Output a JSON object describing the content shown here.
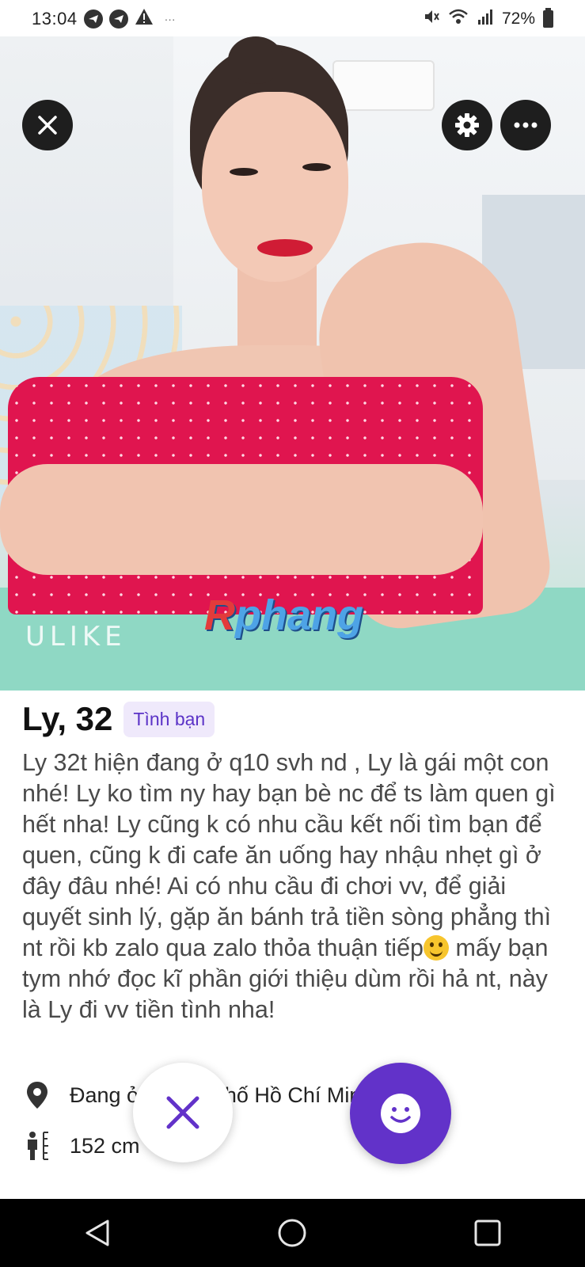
{
  "status_bar": {
    "time": "13:04",
    "battery": "72%",
    "icons": [
      "telegram-icon",
      "telegram-icon",
      "warning-icon",
      "more-dots-icon",
      "mute-icon",
      "wifi-icon",
      "signal-icon",
      "battery-icon"
    ]
  },
  "photo": {
    "watermark_text": "ULIKE",
    "brand_first": "R",
    "brand_rest": "phang"
  },
  "profile": {
    "name_age": "Ly, 32",
    "badge": "Tình bạn",
    "bio_part1": "Ly 32t hiện đang ở q10 svh nd , Ly là gái một con nhé! Ly ko tìm ny hay bạn bè nc để ts làm quen gì hết nha! Ly cũng k có nhu cầu kết nối tìm bạn để quen, cũng k đi cafe ăn uống hay nhậu nhẹt gì ở đây đâu nhé! Ai có nhu cầu đi chơi vv, để giải quyết sinh lý, gặp ăn bánh trả tiền sòng phẳng thì nt rồi kb zalo qua zalo thỏa thuận tiếp",
    "bio_part2": " mấy bạn tym nhớ đọc kĩ phần giới thiệu dùm rồi hả nt, này là Ly đi vv tiền tình nha!",
    "location": "Đang ở Thành phố Hồ Chí Minh",
    "height": "152 cm"
  },
  "colors": {
    "accent": "#6232c9",
    "badge_bg": "#efe9fb",
    "badge_text": "#5b33c7"
  }
}
